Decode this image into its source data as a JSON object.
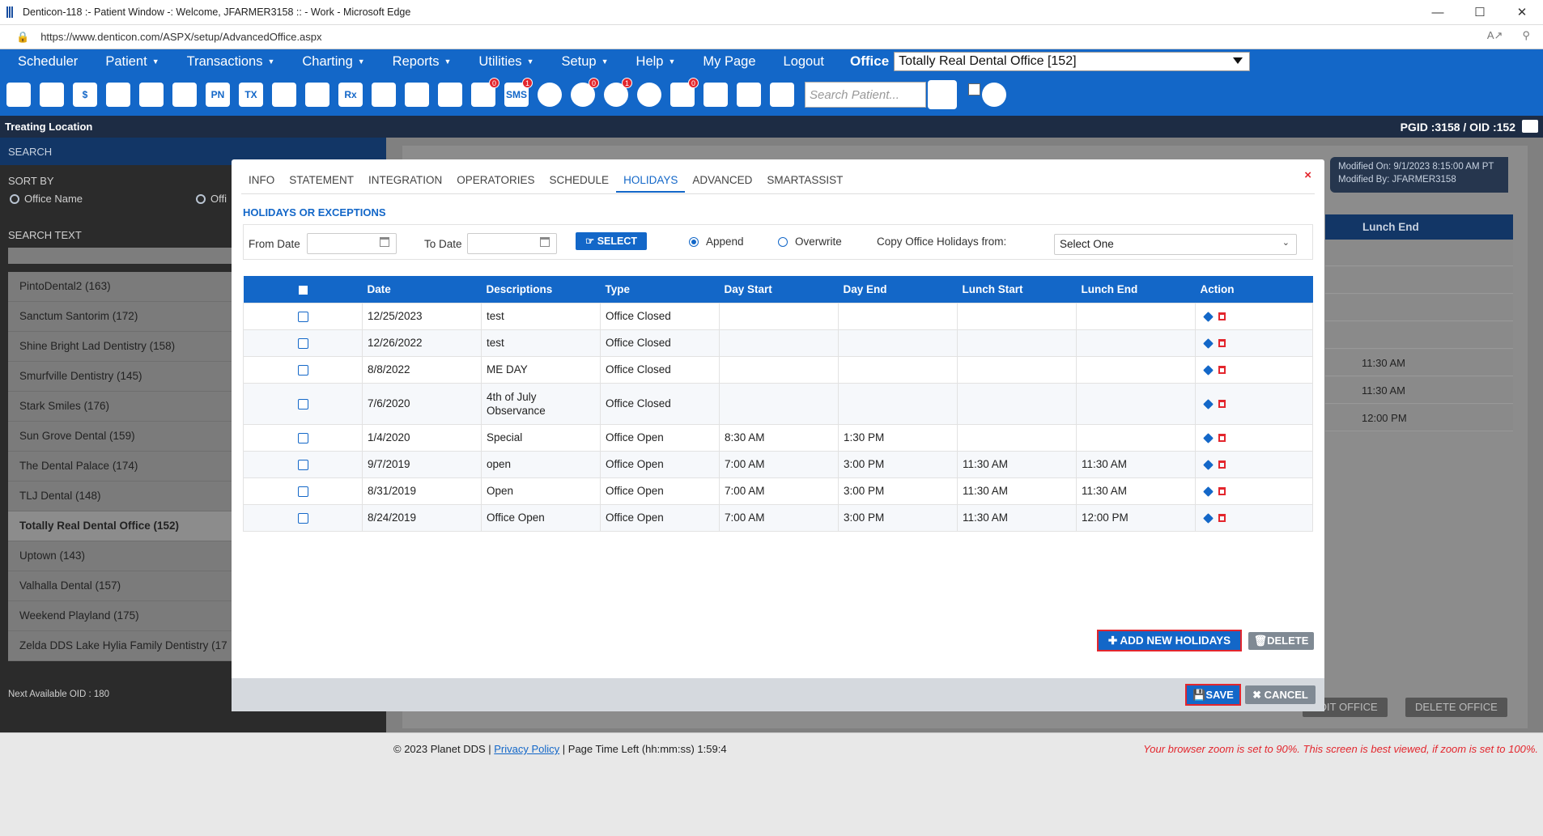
{
  "browser": {
    "title": "Denticon-118 :- Patient Window -: Welcome, JFARMER3158 :: - Work - Microsoft Edge",
    "url": "https://www.denticon.com/ASPX/setup/AdvancedOffice.aspx"
  },
  "menu": {
    "items": [
      "Scheduler",
      "Patient",
      "Transactions",
      "Charting",
      "Reports",
      "Utilities",
      "Setup",
      "Help",
      "My Page",
      "Logout"
    ],
    "office_label": "Office",
    "office_value": "Totally Real Dental Office [152]"
  },
  "toolbar": {
    "search_placeholder": "Search Patient...",
    "icons": [
      {
        "name": "home-icon",
        "text": ""
      },
      {
        "name": "calendar-icon",
        "text": ""
      },
      {
        "name": "dollar-icon",
        "text": "$"
      },
      {
        "name": "notes-icon",
        "text": ""
      },
      {
        "name": "tooth-icon",
        "text": ""
      },
      {
        "name": "tooth-chart-icon",
        "text": ""
      },
      {
        "name": "progress-notes-icon",
        "text": "PN"
      },
      {
        "name": "treatment-icon",
        "text": "TX"
      },
      {
        "name": "add-patient-icon",
        "text": ""
      },
      {
        "name": "add-family-icon",
        "text": ""
      },
      {
        "name": "prescription-icon",
        "text": "Rx"
      },
      {
        "name": "message-icon",
        "text": ""
      },
      {
        "name": "document-icon",
        "text": ""
      },
      {
        "name": "email-icon",
        "text": ""
      },
      {
        "name": "chat-icon",
        "text": "",
        "badge": "0"
      },
      {
        "name": "sms-icon",
        "text": "SMS",
        "badge": "1"
      },
      {
        "name": "clock-icon",
        "text": ""
      },
      {
        "name": "globe-icon",
        "text": "",
        "badge": "0"
      },
      {
        "name": "support-icon",
        "text": "",
        "badge": "1"
      },
      {
        "name": "web-icon",
        "text": ""
      },
      {
        "name": "task-icon",
        "text": "",
        "badge": "0"
      },
      {
        "name": "group-icon",
        "text": ""
      },
      {
        "name": "print-icon",
        "text": ""
      },
      {
        "name": "collapse-icon",
        "text": ""
      }
    ]
  },
  "location_bar": {
    "label": "Treating Location",
    "ids": "PGID :3158  /  OID :152"
  },
  "left_panel": {
    "search_header": "SEARCH",
    "sort_by": "SORT BY",
    "radio_office_name": "Office Name",
    "radio_office_other": "Offi",
    "search_text": "SEARCH TEXT",
    "offices": [
      "PintoDental2 (163)",
      "Sanctum Santorim (172)",
      "Shine Bright Lad Dentistry (158)",
      "Smurfville Dentistry (145)",
      "Stark Smiles (176)",
      "Sun Grove Dental (159)",
      "The Dental Palace (174)",
      "TLJ Dental (148)",
      "Totally Real Dental Office (152)",
      "Uptown (143)",
      "Valhalla Dental (157)",
      "Weekend Playland (175)",
      "Zelda DDS Lake Hylia Family Dentistry (17"
    ],
    "active_index": 8,
    "next_oid": "Next Available OID : 180"
  },
  "behind": {
    "modified_on": "Modified On: 9/1/2023 8:15:00 AM PT",
    "modified_by": "Modified By: JFARMER3158",
    "col_header": "Lunch End",
    "col_values": [
      "",
      "",
      "",
      "",
      "11:30 AM",
      "11:30 AM",
      "12:00 PM"
    ],
    "edit_office": "EDIT OFFICE",
    "delete_office": "DELETE OFFICE"
  },
  "modal": {
    "tabs": [
      "INFO",
      "STATEMENT",
      "INTEGRATION",
      "OPERATORIES",
      "SCHEDULE",
      "HOLIDAYS",
      "ADVANCED",
      "SMARTASSIST"
    ],
    "active_tab": "HOLIDAYS",
    "close": "×",
    "section_title": "HOLIDAYS OR EXCEPTIONS",
    "from_date_label": "From Date",
    "to_date_label": "To Date",
    "select_button": "SELECT",
    "append_label": "Append",
    "overwrite_label": "Overwrite",
    "copy_label": "Copy Office Holidays from:",
    "copy_value": "Select One",
    "columns": [
      "Date",
      "Descriptions",
      "Type",
      "Day Start",
      "Day End",
      "Lunch Start",
      "Lunch End",
      "Action"
    ],
    "rows": [
      {
        "date": "12/25/2023",
        "desc": "test",
        "type": "Office Closed",
        "day_start": "",
        "day_end": "",
        "lunch_start": "",
        "lunch_end": ""
      },
      {
        "date": "12/26/2022",
        "desc": "test",
        "type": "Office Closed",
        "day_start": "",
        "day_end": "",
        "lunch_start": "",
        "lunch_end": ""
      },
      {
        "date": "8/8/2022",
        "desc": "ME DAY",
        "type": "Office Closed",
        "day_start": "",
        "day_end": "",
        "lunch_start": "",
        "lunch_end": ""
      },
      {
        "date": "7/6/2020",
        "desc": "4th of July Observance",
        "type": "Office Closed",
        "day_start": "",
        "day_end": "",
        "lunch_start": "",
        "lunch_end": ""
      },
      {
        "date": "1/4/2020",
        "desc": "Special",
        "type": "Office Open",
        "day_start": "8:30 AM",
        "day_end": "1:30 PM",
        "lunch_start": "",
        "lunch_end": ""
      },
      {
        "date": "9/7/2019",
        "desc": "open",
        "type": "Office Open",
        "day_start": "7:00 AM",
        "day_end": "3:00 PM",
        "lunch_start": "11:30 AM",
        "lunch_end": "11:30 AM"
      },
      {
        "date": "8/31/2019",
        "desc": "Open",
        "type": "Office Open",
        "day_start": "7:00 AM",
        "day_end": "3:00 PM",
        "lunch_start": "11:30 AM",
        "lunch_end": "11:30 AM"
      },
      {
        "date": "8/24/2019",
        "desc": "Office Open",
        "type": "Office Open",
        "day_start": "7:00 AM",
        "day_end": "3:00 PM",
        "lunch_start": "11:30 AM",
        "lunch_end": "12:00 PM"
      }
    ],
    "add_button": "ADD NEW HOLIDAYS",
    "delete_button": "DELETE",
    "save_button": "SAVE",
    "cancel_button": "CANCEL"
  },
  "footer": {
    "copyright": "© 2023 Planet DDS | ",
    "privacy": "Privacy Policy",
    "time_left": " | Page Time Left (hh:mm:ss) 1:59:4",
    "zoom_warning": "Your browser zoom is set to 90%. This screen is best viewed, if zoom is set to 100%."
  },
  "colors": {
    "brand_blue": "#1367c8",
    "dark_navy": "#1d2c44",
    "alert_red": "#e3262d"
  }
}
